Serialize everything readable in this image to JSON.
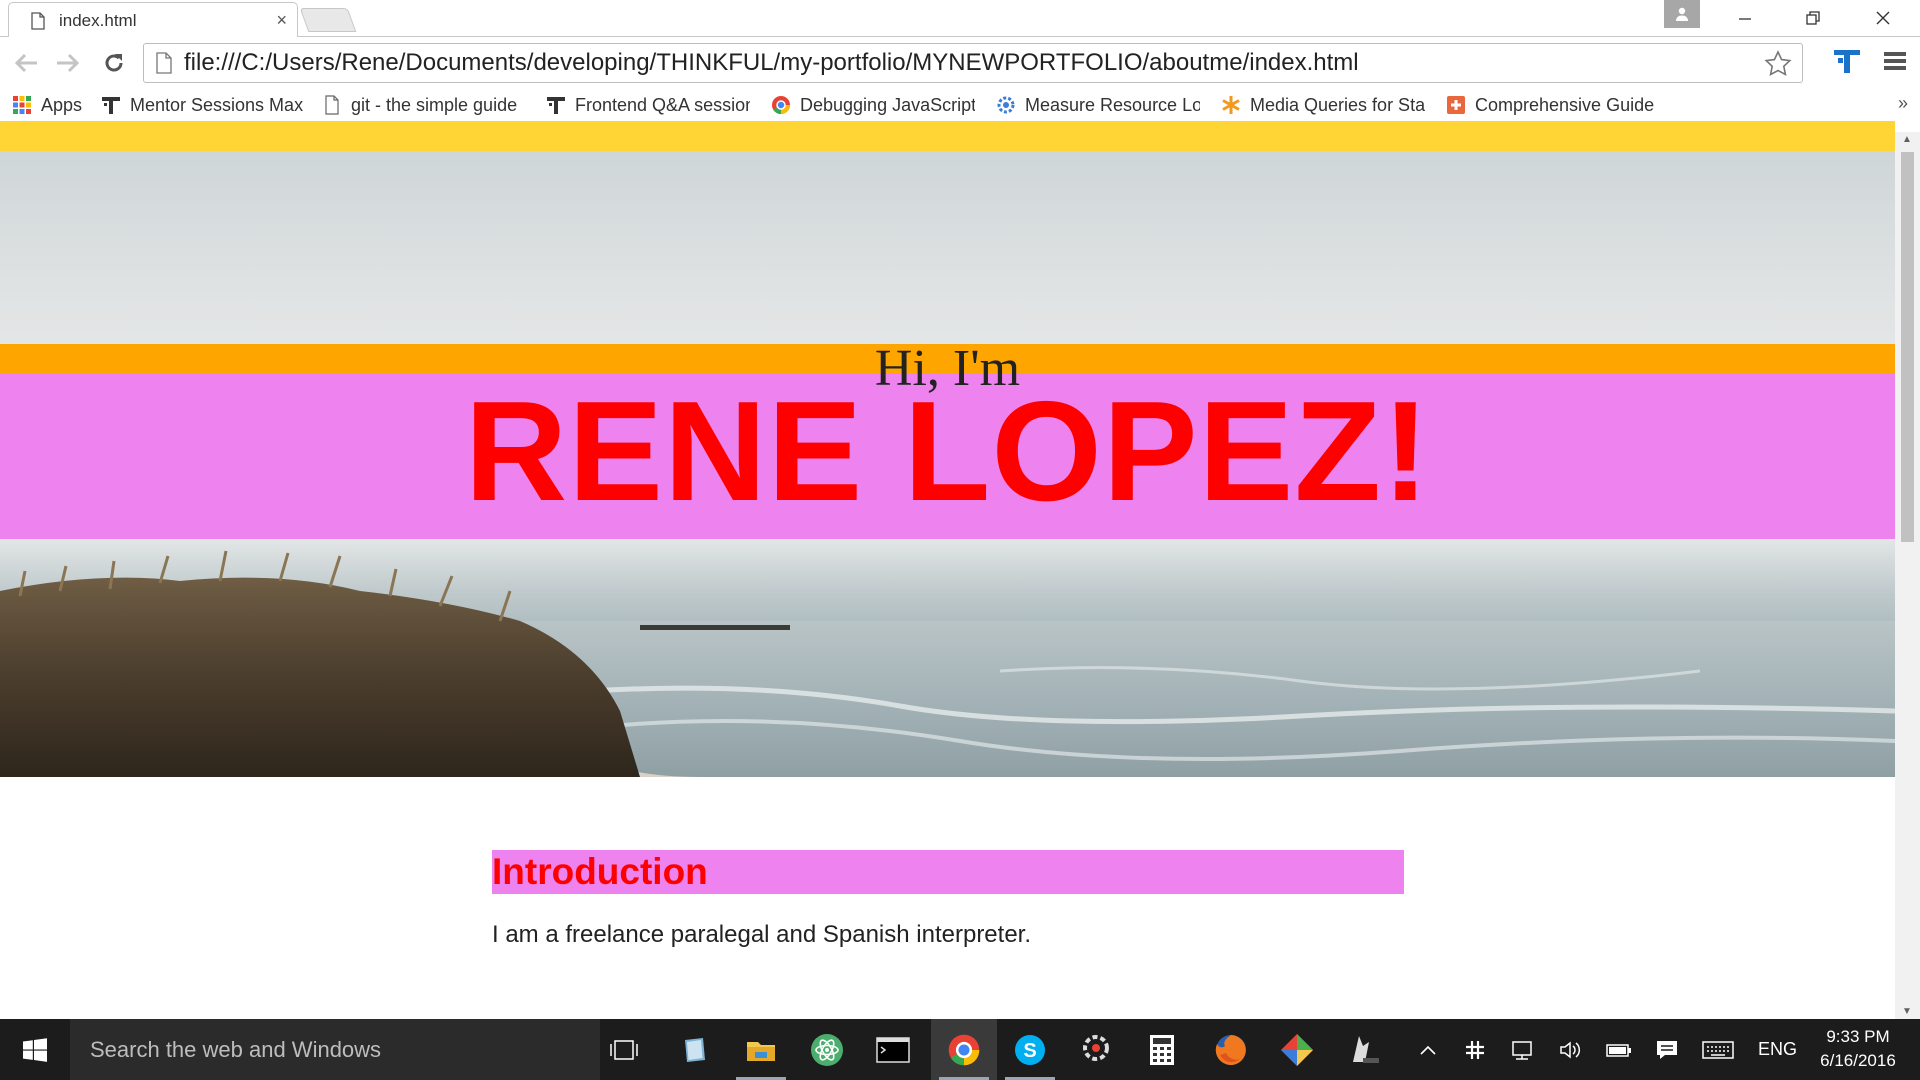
{
  "window": {
    "tab_title": "index.html",
    "tab_close": "×",
    "url": "file:///C:/Users/Rene/Documents/developing/THINKFUL/my-portfolio/MYNEWPORTFOLIO/aboutme/index.html"
  },
  "bookmarks": [
    {
      "label": "Apps",
      "icon": "apps-grid-icon"
    },
    {
      "label": "Mentor Sessions Max",
      "icon": "thinkful-icon"
    },
    {
      "label": "git - the simple guide",
      "icon": "page-icon"
    },
    {
      "label": "Frontend Q&A session",
      "icon": "thinkful-icon"
    },
    {
      "label": "Debugging JavaScript",
      "icon": "chrome-icon"
    },
    {
      "label": "Measure Resource Lo",
      "icon": "gear-blue-icon"
    },
    {
      "label": "Media Queries for Sta",
      "icon": "asterisk-icon"
    },
    {
      "label": "Comprehensive Guide",
      "icon": "plus-box-icon"
    }
  ],
  "bookmarks_more": "»",
  "page": {
    "greeting": "Hi, I'm",
    "name": "RENE LOPEZ!",
    "intro_heading": "Introduction",
    "intro_text": "I am a freelance paralegal and Spanish interpreter."
  },
  "colors": {
    "top_strip": "#ffd535",
    "orange_band": "#ffa500",
    "pink_band": "#ee82ee",
    "name_red": "#ff0000"
  },
  "taskbar": {
    "search_placeholder": "Search the web and Windows",
    "language": "ENG",
    "time": "9:33 PM",
    "date": "6/16/2016",
    "apps": [
      "task-view-icon",
      "notepad-icon",
      "file-explorer-icon",
      "atom-icon",
      "terminal-icon",
      "chrome-icon",
      "skype-icon",
      "photoscape-icon",
      "calculator-icon",
      "firefox-icon",
      "git-icon",
      "inkscape-icon"
    ]
  }
}
